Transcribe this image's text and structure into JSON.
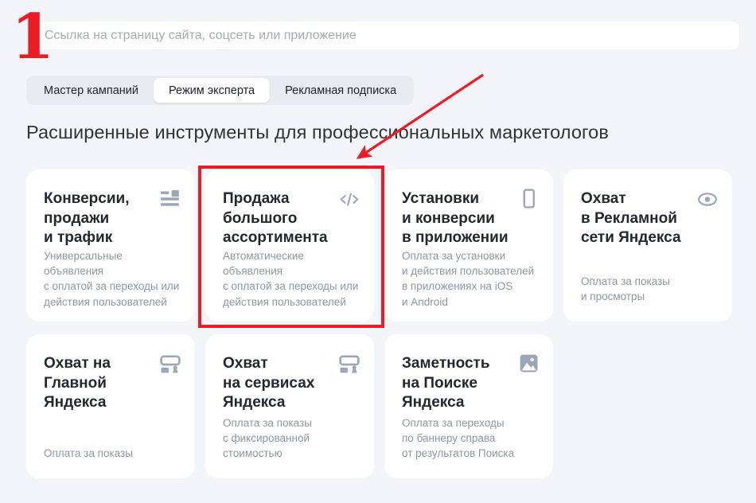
{
  "annotations": {
    "step_number": "1",
    "accent_color": "#ed1c24"
  },
  "url_input": {
    "value": "",
    "placeholder": "Ссылка на страницу сайта, соцсеть или приложение"
  },
  "tabs": [
    {
      "label": "Мастер кампаний",
      "active": false
    },
    {
      "label": "Режим эксперта",
      "active": true
    },
    {
      "label": "Рекламная подписка",
      "active": false
    }
  ],
  "heading": "Расширенные инструменты для профессиональных маркетологов",
  "cards": [
    {
      "title": "Конверсии,\nпродажи\nи трафик",
      "icon": "text-ad-icon",
      "description": "Универсальные объявления\nс оплатой за переходы или\nдействия пользователей",
      "highlighted": false
    },
    {
      "title": "Продажа\nбольшого\nассортимента",
      "icon": "code-icon",
      "description": "Автоматические объявления\nс оплатой за переходы или\nдействия пользователей",
      "highlighted": true
    },
    {
      "title": "Установки\nи конверсии\nв приложении",
      "icon": "phone-icon",
      "description": "Оплата за установки\nи действия пользователей\nв приложениях на iOS\nи Android",
      "highlighted": false
    },
    {
      "title": "Охват\nв Рекламной\nсети Яндекса",
      "icon": "eye-icon",
      "description": "Оплата за показы\nи просмотры",
      "highlighted": false
    },
    {
      "title": "Охват на\nГлавной\nЯндекса",
      "icon": "billboard-icon",
      "description": "Оплата за показы",
      "highlighted": false
    },
    {
      "title": "Охват\nна сервисах\nЯндекса",
      "icon": "billboard-icon",
      "description": "Оплата за показы\nс фиксированной\nстоимостью",
      "highlighted": false
    },
    {
      "title": "Заметность\nна Поиске\nЯндекса",
      "icon": "picture-icon",
      "description": "Оплата за переходы\nпо баннеру справа\nот результатов Поиска",
      "highlighted": false
    }
  ]
}
